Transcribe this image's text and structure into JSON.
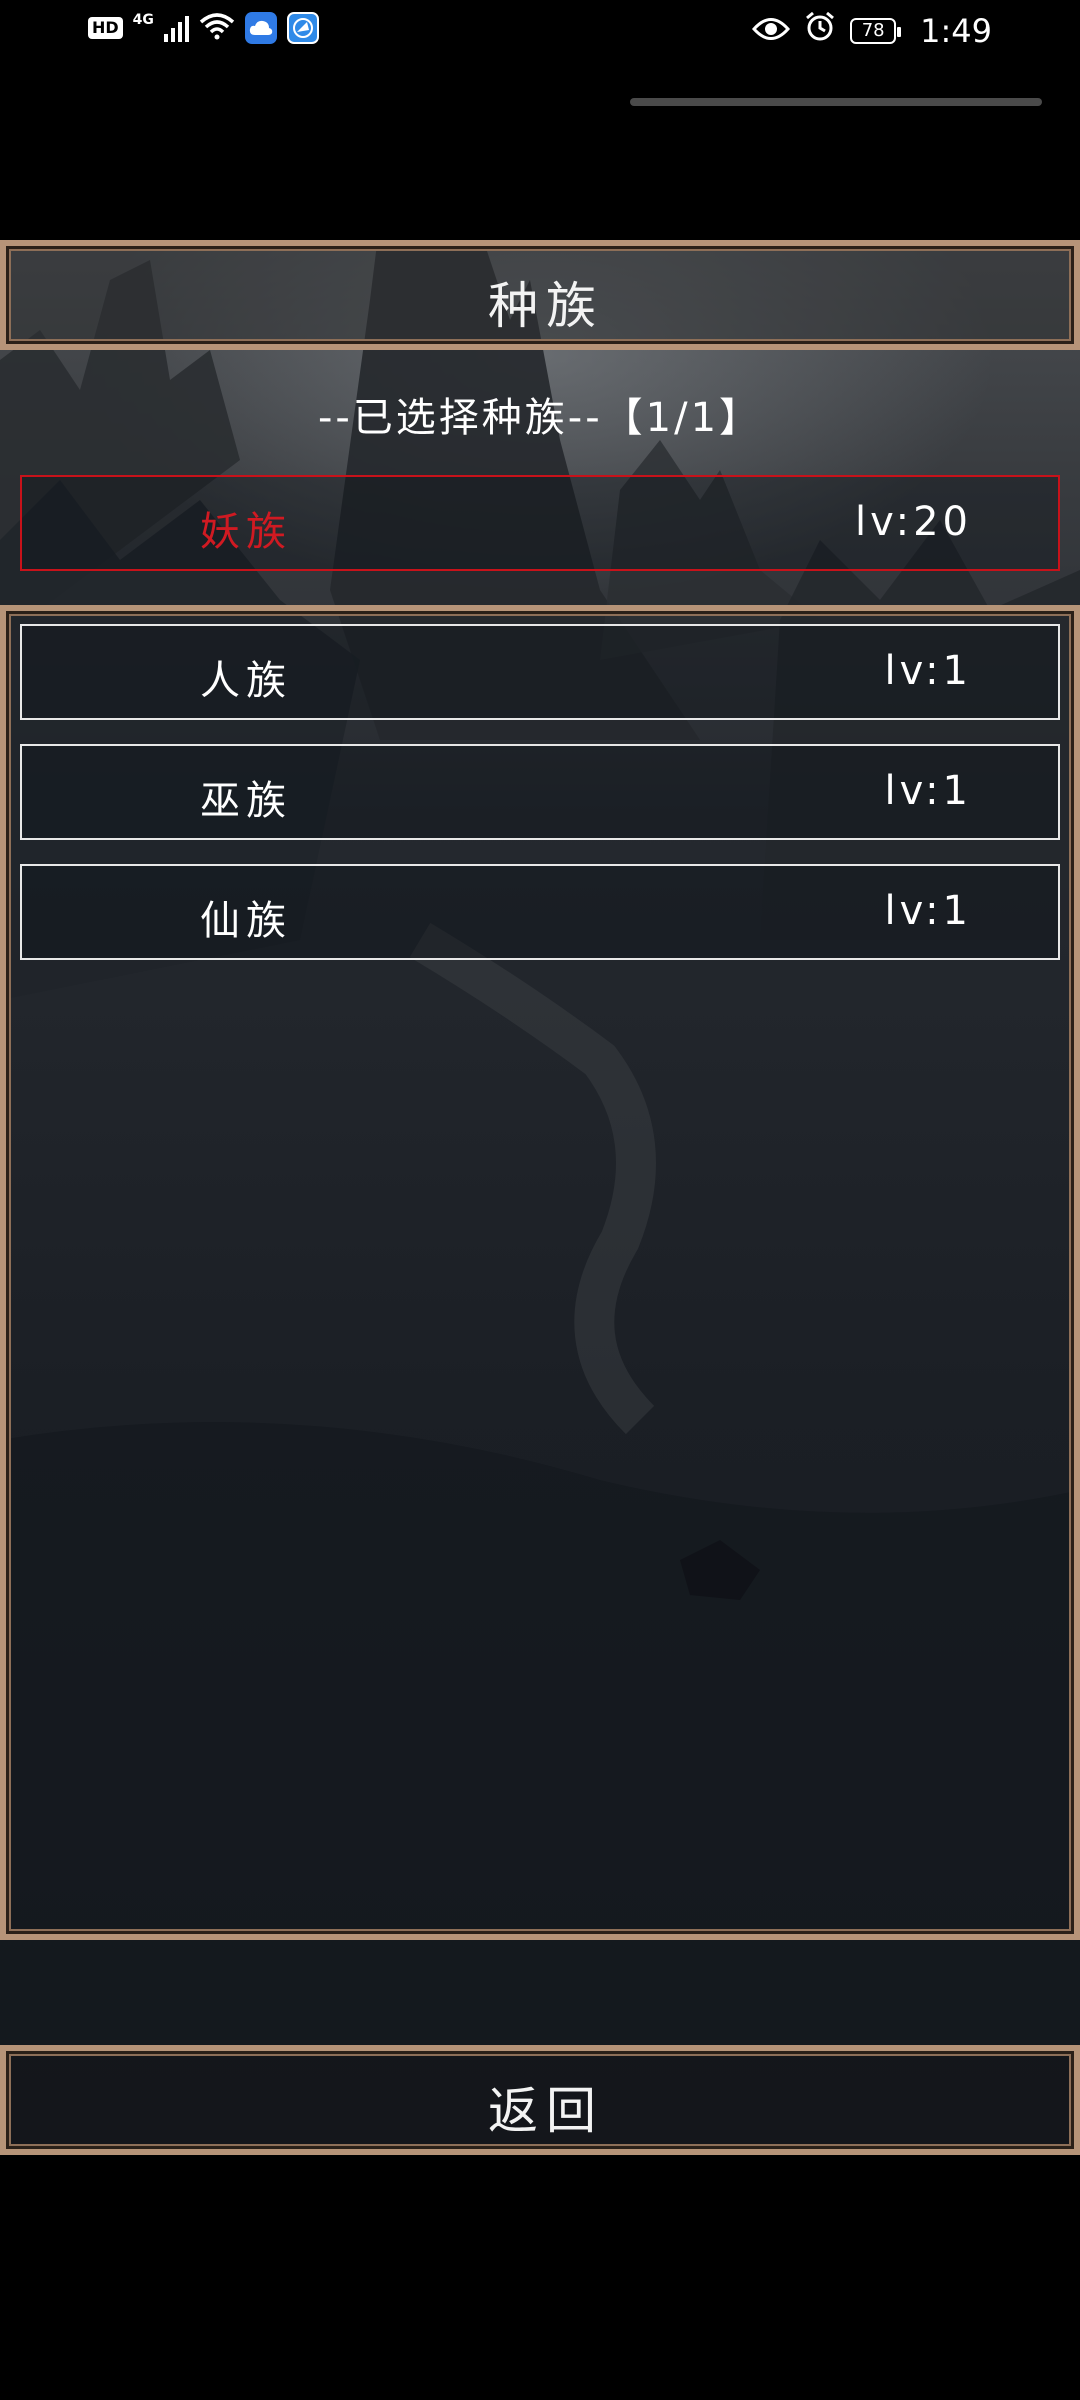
{
  "status_bar": {
    "hd": "HD",
    "network": "4G",
    "battery": "78",
    "time": "1:49"
  },
  "screen": {
    "title": "种族",
    "selected_summary": "--已选择种族--【1/1】",
    "selected_race": {
      "name": "妖族",
      "level": "lv:20"
    },
    "races": [
      {
        "name": "人族",
        "level": "lv:1"
      },
      {
        "name": "巫族",
        "level": "lv:1"
      },
      {
        "name": "仙族",
        "level": "lv:1"
      }
    ],
    "back_label": "返回"
  },
  "colors": {
    "frame_gold": "#b69478",
    "selected_red": "#d01a22",
    "text": "#ffffff"
  }
}
